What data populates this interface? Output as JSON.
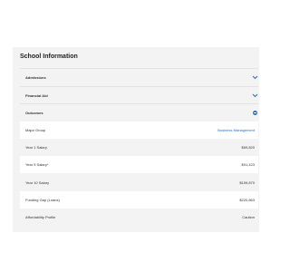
{
  "card": {
    "title": "School Information"
  },
  "sections": [
    {
      "label": "Admissions",
      "state": "collapsed",
      "icon": "chevron-down-icon"
    },
    {
      "label": "Financial Aid",
      "state": "collapsed",
      "icon": "chevron-down-icon"
    },
    {
      "label": "Outcomes",
      "state": "expanded",
      "icon": "minus-circle-icon"
    }
  ],
  "outcomes": {
    "rows": [
      {
        "label": "Major Group",
        "value": "Business Management",
        "value_is_link": true
      },
      {
        "label": "Year 1 Salary",
        "value": "$69,820"
      },
      {
        "label": "Year 5 Salary*",
        "value": "$91,423"
      },
      {
        "label": "Year 10 Salary",
        "value": "$159,870"
      },
      {
        "label": "Funding Gap (Loans)",
        "value": "$220,863"
      },
      {
        "label": "Affordability Profile",
        "value": "Caution"
      }
    ]
  },
  "colors": {
    "accent": "#1d6fd8",
    "panel_bg": "#f3f3f3",
    "row_white": "#ffffff"
  }
}
